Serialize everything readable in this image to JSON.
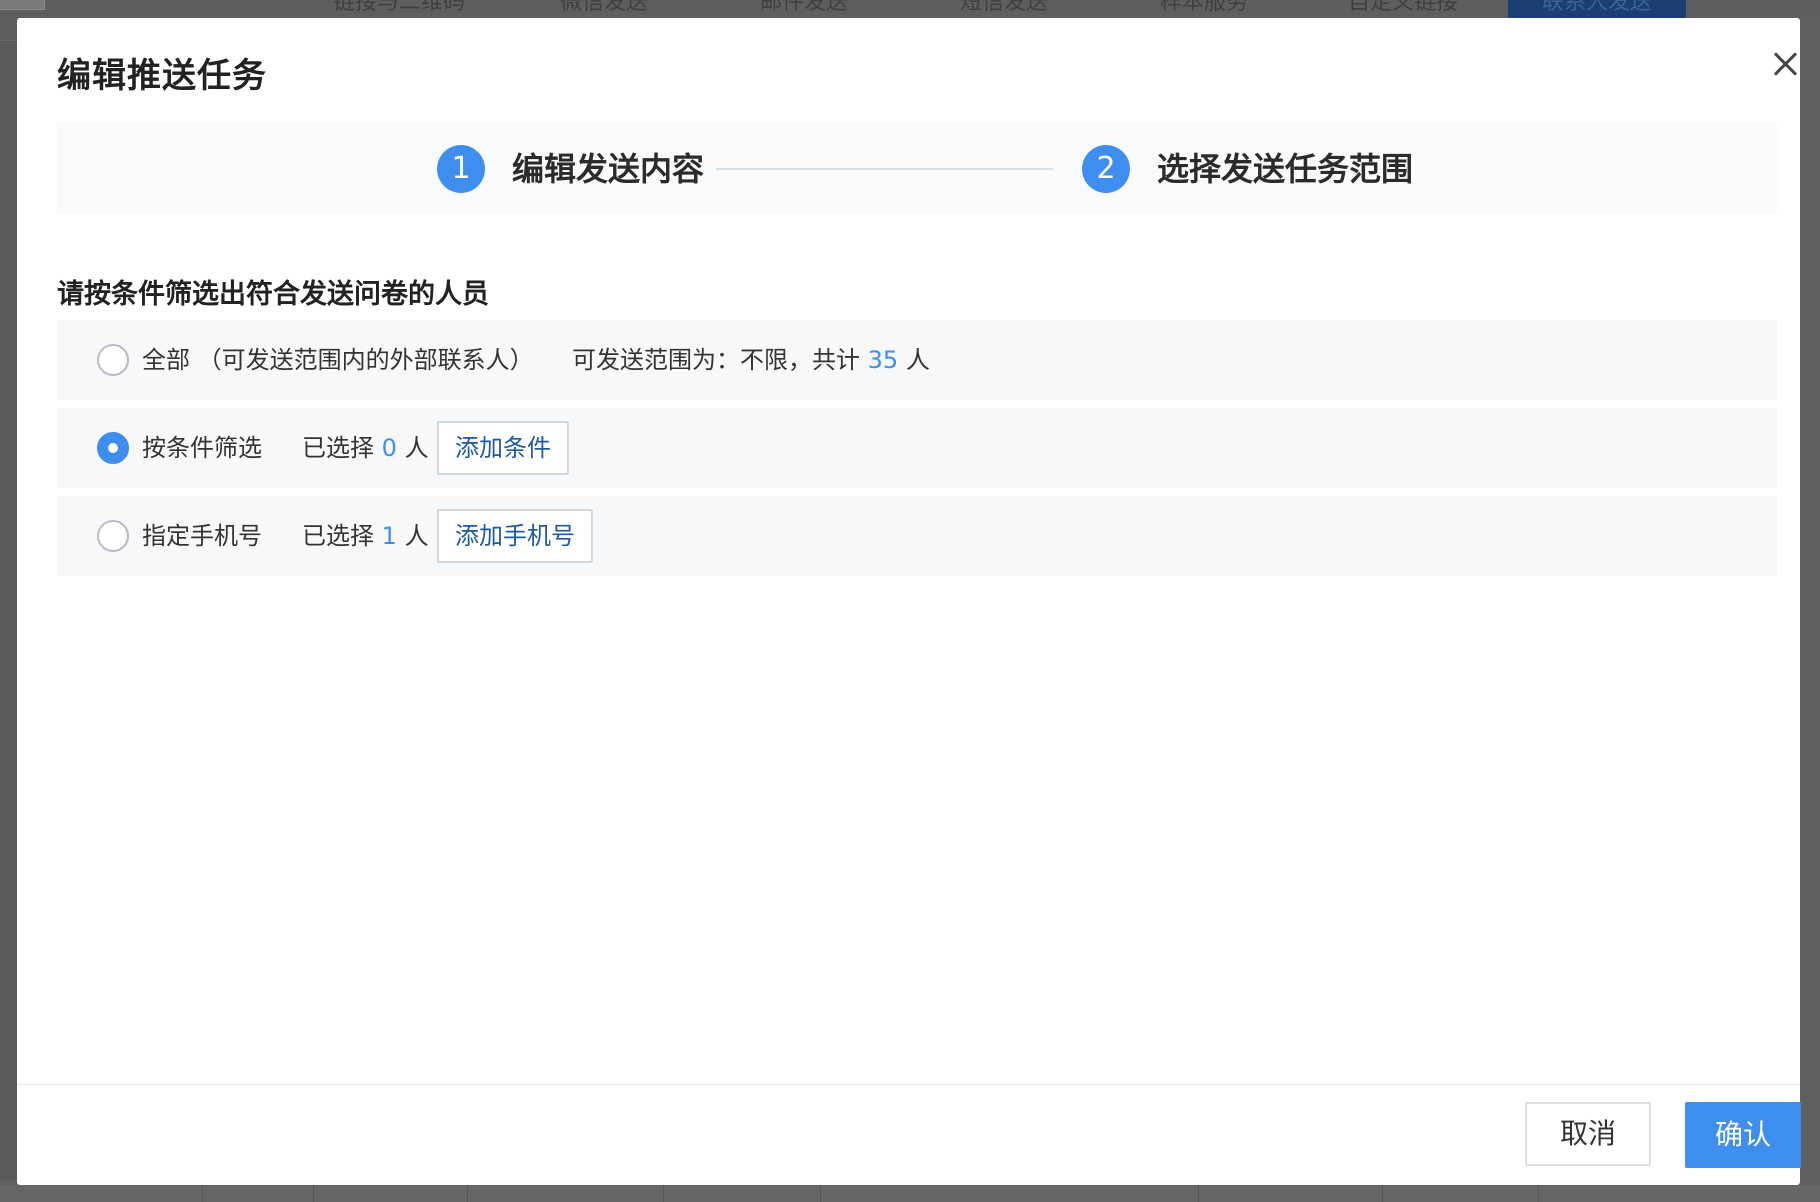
{
  "background": {
    "tabs": [
      "链接与二维码",
      "微信发送",
      "邮件发送",
      "短信发送",
      "样本服务",
      "自定义链接",
      "联系人发送"
    ],
    "active_tab": "联系人发送"
  },
  "modal": {
    "title": "编辑推送任务",
    "steps": [
      {
        "number": "1",
        "label": "编辑发送内容"
      },
      {
        "number": "2",
        "label": "选择发送任务范围"
      }
    ],
    "section_title": "请按条件筛选出符合发送问卷的人员",
    "options": {
      "all": {
        "label": "全部 （可发送范围内的外部联系人）",
        "scope_prefix": "可发送范围为：不限，共计",
        "count": "35",
        "unit": "人",
        "selected": false
      },
      "filter": {
        "label": "按条件筛选",
        "selected_prefix": "已选择",
        "count": "0",
        "unit": "人",
        "button": "添加条件",
        "selected": true
      },
      "phone": {
        "label": "指定手机号",
        "selected_prefix": "已选择",
        "count": "1",
        "unit": "人",
        "button": "添加手机号",
        "selected": false
      }
    },
    "footer": {
      "cancel": "取消",
      "confirm": "确认"
    }
  },
  "colors": {
    "accent": "#3e8ef0",
    "link": "#1e5aa0",
    "row_bg": "#f7f8fa",
    "overlay": "#5f5f5f"
  }
}
